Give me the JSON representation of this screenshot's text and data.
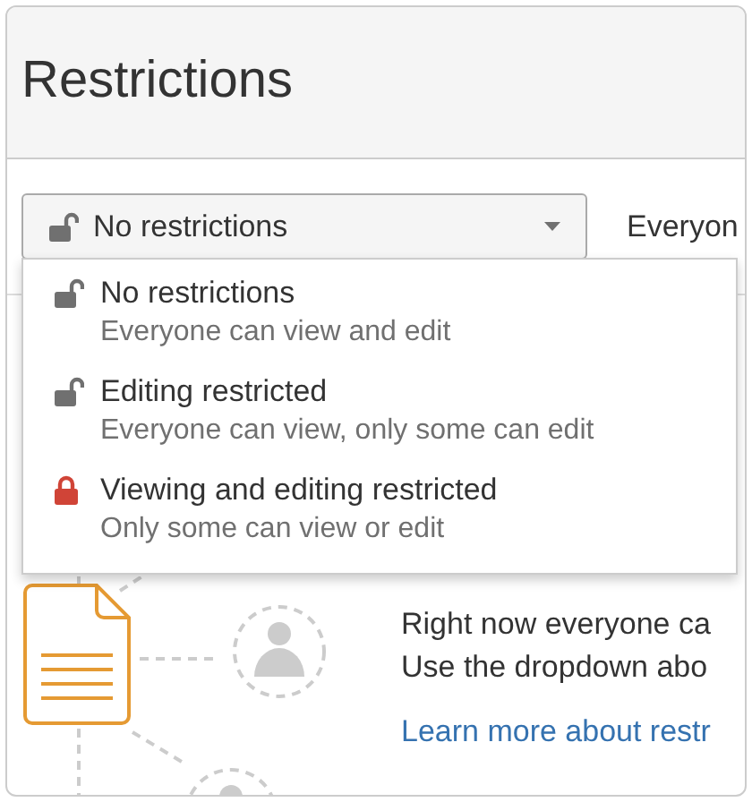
{
  "dialog": {
    "title": "Restrictions"
  },
  "select": {
    "value": "No restrictions",
    "kind": "unlocked"
  },
  "beside_text": "Everyon",
  "menu": [
    {
      "kind": "unlocked",
      "label": "No restrictions",
      "description": "Everyone can view and edit"
    },
    {
      "kind": "unlocked",
      "label": "Editing restricted",
      "description": "Everyone can view, only some can edit"
    },
    {
      "kind": "locked",
      "label": "Viewing and editing restricted",
      "description": "Only some can view or edit"
    }
  ],
  "info": {
    "lines": [
      "Right now everyone ca",
      "Use the dropdown abo"
    ],
    "link": "Learn more about restr"
  }
}
